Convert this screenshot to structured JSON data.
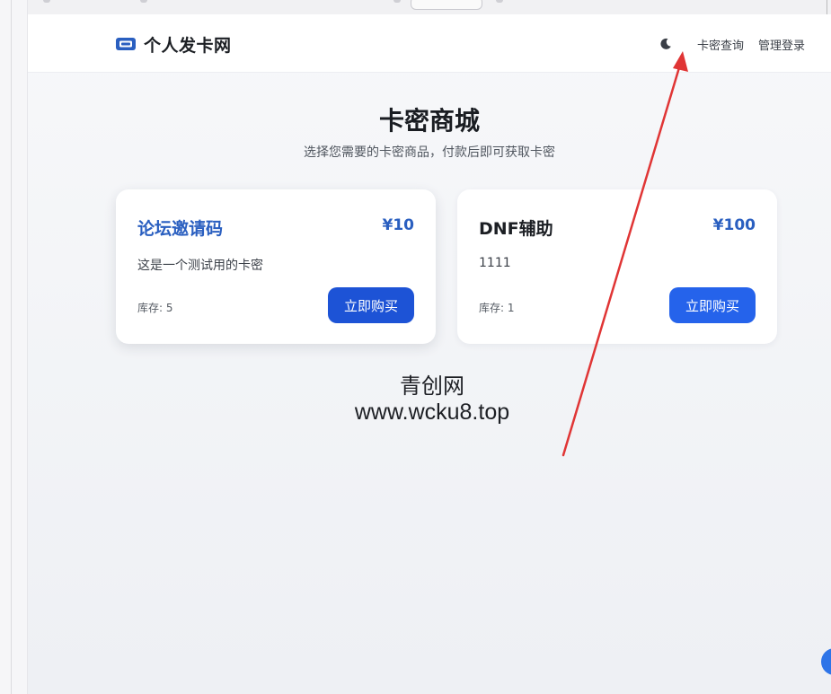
{
  "nav": {
    "brand": "个人发卡网",
    "links": [
      "卡密查询",
      "管理登录"
    ]
  },
  "hero": {
    "title": "卡密商城",
    "subtitle": "选择您需要的卡密商品，付款后即可获取卡密"
  },
  "products": [
    {
      "name": "论坛邀请码",
      "price": "¥10",
      "description": "这是一个测试用的卡密",
      "stock": "库存: 5",
      "button": "立即购买"
    },
    {
      "name": "DNF辅助",
      "price": "¥100",
      "description": "1111",
      "stock": "库存: 1",
      "button": "立即购买"
    }
  ],
  "watermark": {
    "line1": "青创网",
    "line2": "www.wcku8.top"
  },
  "colors": {
    "accent": "#2a5fc0",
    "button": "#1d53d6",
    "annotation_arrow": "#e03535"
  },
  "icons": {
    "brand": "ticket-icon",
    "theme": "moon-icon"
  }
}
